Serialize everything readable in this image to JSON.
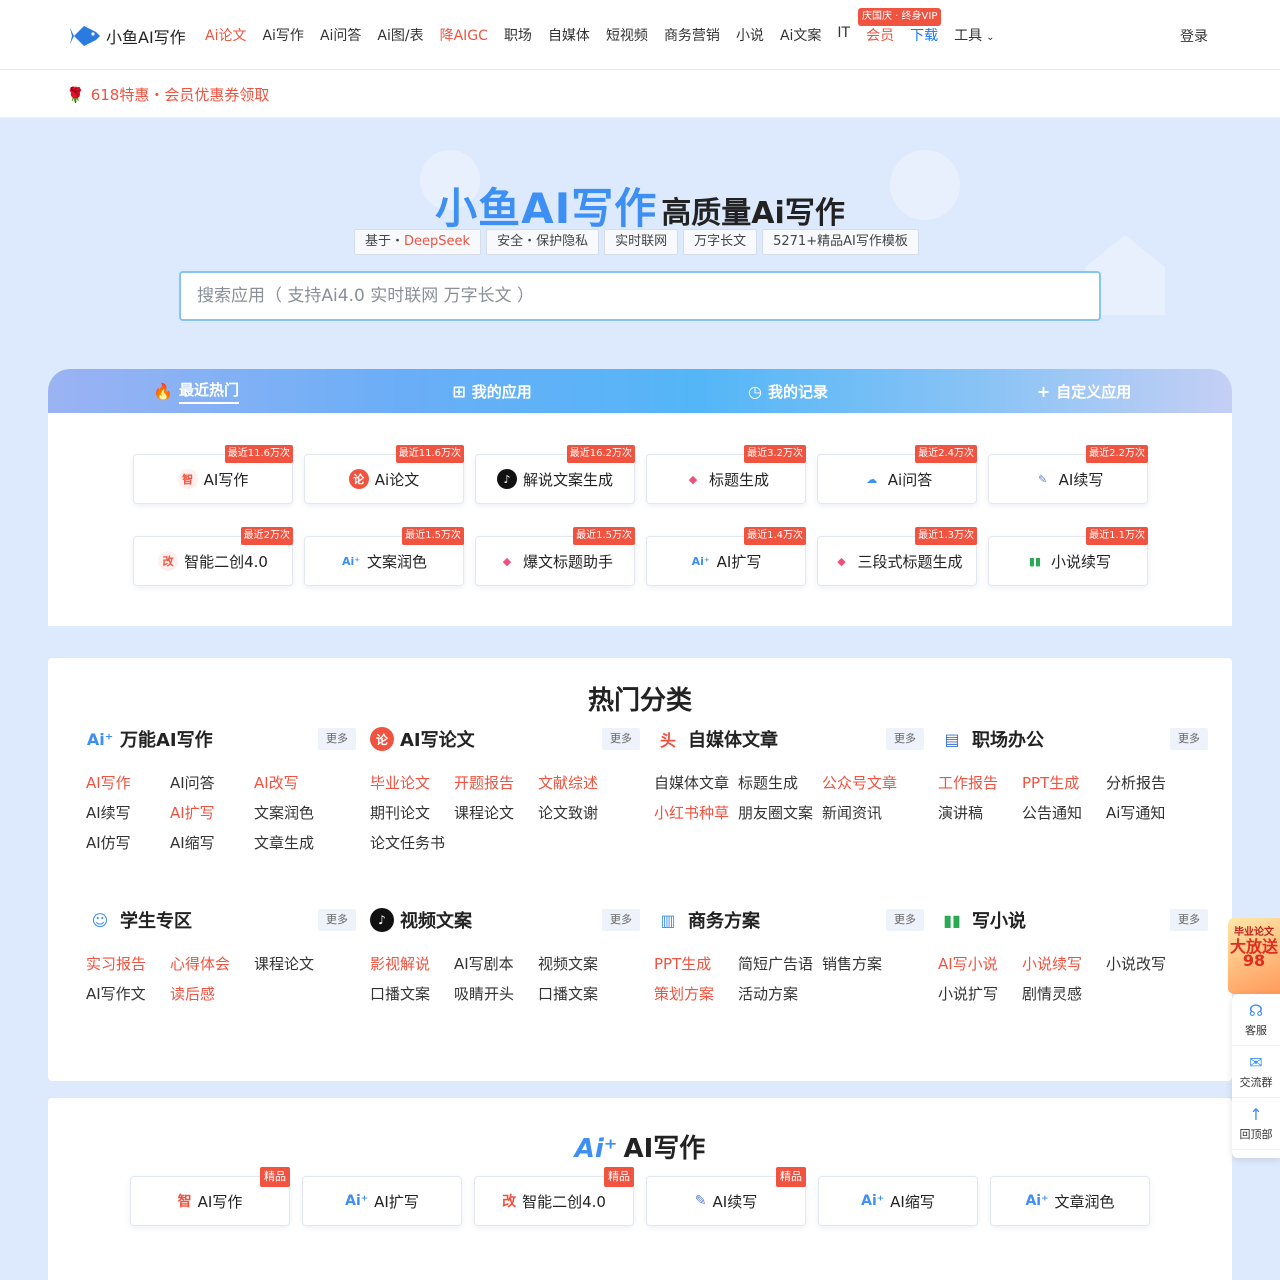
{
  "header": {
    "logo_text": "小鱼AI写作",
    "menu": [
      {
        "label": "Ai论文",
        "style": "red"
      },
      {
        "label": "Ai写作",
        "style": ""
      },
      {
        "label": "Ai问答",
        "style": ""
      },
      {
        "label": "Ai图/表",
        "style": ""
      },
      {
        "label": "降AIGC",
        "style": "red"
      },
      {
        "label": "职场",
        "style": ""
      },
      {
        "label": "自媒体",
        "style": ""
      },
      {
        "label": "短视频",
        "style": ""
      },
      {
        "label": "商务营销",
        "style": ""
      },
      {
        "label": "小说",
        "style": ""
      },
      {
        "label": "Ai文案",
        "style": ""
      },
      {
        "label": "IT",
        "style": ""
      },
      {
        "label": "会员",
        "style": "red"
      },
      {
        "label": "下载",
        "style": "blue"
      },
      {
        "label": "工具",
        "style": "",
        "chevron": true
      }
    ],
    "vip_tag": "庆国庆 · 终身VIP",
    "login": "登录"
  },
  "promo": {
    "icon": "rose-icon",
    "text": "618特惠・会员优惠券领取"
  },
  "hero": {
    "title_brand": "小鱼AI写作",
    "title_sub": "高质量Ai写作",
    "chips": [
      {
        "prefix": "基于・",
        "highlight": "DeepSeek"
      },
      {
        "prefix": "安全・保护隐私",
        "highlight": ""
      },
      {
        "prefix": "实时联网",
        "highlight": ""
      },
      {
        "prefix": "万字长文",
        "highlight": ""
      },
      {
        "prefix": "5271+精品AI写作模板",
        "highlight": ""
      }
    ],
    "search_placeholder": "搜索应用（ 支持Ai4.0 实时联网 万字长文 ）"
  },
  "tabs": [
    {
      "label": "最近热门",
      "icon": "flame-icon",
      "active": true
    },
    {
      "label": "我的应用",
      "icon": "grid-icon",
      "active": false
    },
    {
      "label": "我的记录",
      "icon": "clock-icon",
      "active": false
    },
    {
      "label": "自定义应用",
      "icon": "plus-icon",
      "active": false
    }
  ],
  "hot_apps": [
    {
      "label": "AI写作",
      "badge": "最近11.6万次",
      "icon": "zhi-icon"
    },
    {
      "label": "Ai论文",
      "badge": "最近11.6万次",
      "icon": "paper-icon"
    },
    {
      "label": "解说文案生成",
      "badge": "最近16.2万次",
      "icon": "tiktok-icon"
    },
    {
      "label": "标题生成",
      "badge": "最近3.2万次",
      "icon": "tag-icon"
    },
    {
      "label": "Ai问答",
      "badge": "最近2.4万次",
      "icon": "chat-icon"
    },
    {
      "label": "AI续写",
      "badge": "最近2.2万次",
      "icon": "pen-icon"
    },
    {
      "label": "智能二创4.0",
      "badge": "最近2万次",
      "icon": "edit-icon"
    },
    {
      "label": "文案润色",
      "badge": "最近1.5万次",
      "icon": "ai-icon"
    },
    {
      "label": "爆文标题助手",
      "badge": "最近1.5万次",
      "icon": "tag-icon"
    },
    {
      "label": "AI扩写",
      "badge": "最近1.4万次",
      "icon": "ai-icon"
    },
    {
      "label": "三段式标题生成",
      "badge": "最近1.3万次",
      "icon": "tag-icon"
    },
    {
      "label": "小说续写",
      "badge": "最近1.1万次",
      "icon": "book-icon"
    }
  ],
  "categories": {
    "title": "热门分类",
    "more_label": "更多",
    "groups": [
      {
        "name": "万能AI写作",
        "icon": "ai-icon",
        "links": [
          {
            "t": "AI写作",
            "r": true
          },
          {
            "t": "AI问答",
            "r": false
          },
          {
            "t": "AI改写",
            "r": true
          },
          {
            "t": "AI续写",
            "r": false
          },
          {
            "t": "AI扩写",
            "r": true
          },
          {
            "t": "文案润色",
            "r": false
          },
          {
            "t": "AI仿写",
            "r": false
          },
          {
            "t": "AI缩写",
            "r": false
          },
          {
            "t": "文章生成",
            "r": false
          }
        ]
      },
      {
        "name": "AI写论文",
        "icon": "paper-icon",
        "links": [
          {
            "t": "毕业论文",
            "r": true
          },
          {
            "t": "开题报告",
            "r": true
          },
          {
            "t": "文献综述",
            "r": true
          },
          {
            "t": "期刊论文",
            "r": false
          },
          {
            "t": "课程论文",
            "r": false
          },
          {
            "t": "论文致谢",
            "r": false
          },
          {
            "t": "论文任务书",
            "r": false
          }
        ]
      },
      {
        "name": "自媒体文章",
        "icon": "media-icon",
        "links": [
          {
            "t": "自媒体文章",
            "r": false
          },
          {
            "t": "标题生成",
            "r": false
          },
          {
            "t": "公众号文章",
            "r": true
          },
          {
            "t": "小红书种草",
            "r": true
          },
          {
            "t": "朋友圈文案",
            "r": false
          },
          {
            "t": "新闻资讯",
            "r": false
          }
        ]
      },
      {
        "name": "职场办公",
        "icon": "office-icon",
        "links": [
          {
            "t": "工作报告",
            "r": true
          },
          {
            "t": "PPT生成",
            "r": true
          },
          {
            "t": "分析报告",
            "r": false
          },
          {
            "t": "演讲稿",
            "r": false
          },
          {
            "t": "公告通知",
            "r": false
          },
          {
            "t": "Ai写通知",
            "r": false
          }
        ]
      },
      {
        "name": "学生专区",
        "icon": "student-icon",
        "links": [
          {
            "t": "实习报告",
            "r": true
          },
          {
            "t": "心得体会",
            "r": true
          },
          {
            "t": "课程论文",
            "r": false
          },
          {
            "t": "AI写作文",
            "r": false
          },
          {
            "t": "读后感",
            "r": true
          }
        ]
      },
      {
        "name": "视频文案",
        "icon": "tiktok-icon",
        "links": [
          {
            "t": "影视解说",
            "r": true
          },
          {
            "t": "AI写剧本",
            "r": false
          },
          {
            "t": "视频文案",
            "r": false
          },
          {
            "t": "口播文案",
            "r": false
          },
          {
            "t": "吸睛开头",
            "r": false
          },
          {
            "t": "口播文案",
            "r": false
          }
        ]
      },
      {
        "name": "商务方案",
        "icon": "business-icon",
        "links": [
          {
            "t": "PPT生成",
            "r": true
          },
          {
            "t": "简短广告语",
            "r": false
          },
          {
            "t": "销售方案",
            "r": false
          },
          {
            "t": "策划方案",
            "r": true
          },
          {
            "t": "活动方案",
            "r": false
          }
        ]
      },
      {
        "name": "写小说",
        "icon": "book-icon",
        "links": [
          {
            "t": "AI写小说",
            "r": true
          },
          {
            "t": "小说续写",
            "r": true
          },
          {
            "t": "小说改写",
            "r": false
          },
          {
            "t": "小说扩写",
            "r": false
          },
          {
            "t": "剧情灵感",
            "r": false
          }
        ]
      }
    ]
  },
  "ai_writing": {
    "title": "AI写作",
    "cards": [
      {
        "label": "AI写作",
        "icon": "zhi-icon",
        "tag": "精品"
      },
      {
        "label": "AI扩写",
        "icon": "ai-icon",
        "tag": ""
      },
      {
        "label": "智能二创4.0",
        "icon": "edit-icon",
        "tag": "精品"
      },
      {
        "label": "AI续写",
        "icon": "pen-icon",
        "tag": "精品"
      },
      {
        "label": "AI缩写",
        "icon": "ai-icon",
        "tag": ""
      },
      {
        "label": "文章润色",
        "icon": "ai-icon",
        "tag": ""
      }
    ]
  },
  "float": {
    "ad_line1": "毕业论文",
    "ad_line2": "大放送",
    "ad_line3": "98",
    "items": [
      {
        "label": "客服",
        "icon": "headset-icon"
      },
      {
        "label": "交流群",
        "icon": "wechat-icon"
      },
      {
        "label": "回顶部",
        "icon": "arrow-up-icon"
      }
    ]
  },
  "colors": {
    "accent": "#3d8ff3",
    "red": "#f05340",
    "page_bg": "#dde9fc"
  }
}
